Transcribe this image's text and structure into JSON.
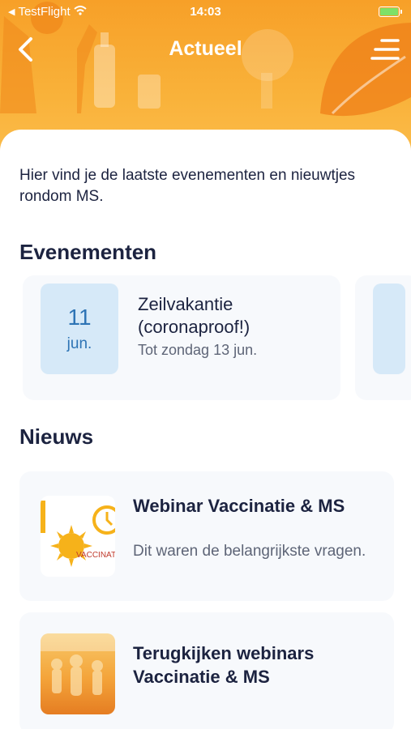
{
  "status_bar": {
    "carrier": "TestFlight",
    "time": "14:03"
  },
  "nav": {
    "title": "Actueel"
  },
  "intro": "Hier vind je de laatste evenementen en nieuwtjes rondom MS.",
  "events": {
    "heading": "Evenementen",
    "items": [
      {
        "day": "11",
        "month": "jun.",
        "title": "Zeilvakantie (coronaproof!)",
        "subtitle": "Tot zondag 13 jun."
      }
    ]
  },
  "news": {
    "heading": "Nieuws",
    "items": [
      {
        "title": "Webinar Vaccinatie & MS",
        "subtitle": "Dit waren de belangrijkste vragen.",
        "thumb_text": "VACCINAT"
      },
      {
        "title": "Terugkijken webinars Vaccinatie & MS",
        "subtitle": ""
      }
    ]
  },
  "colors": {
    "header_orange": "#f7a028",
    "date_badge_bg": "#d6e9f8",
    "date_text": "#2e74b5",
    "card_bg": "#f7f9fc",
    "heading_text": "#1c2340"
  }
}
